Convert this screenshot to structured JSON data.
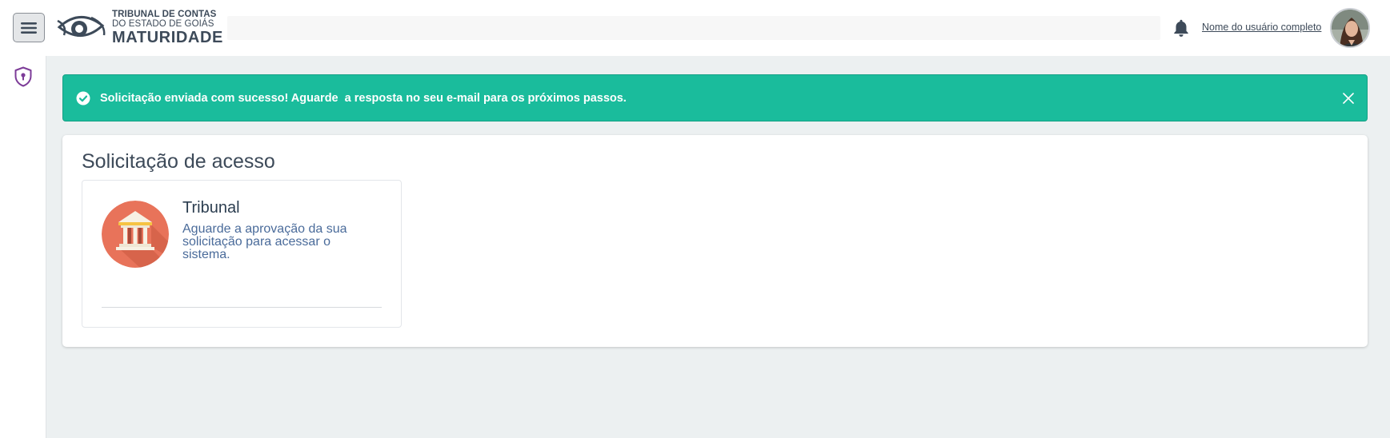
{
  "header": {
    "logo": {
      "line1": "TRIBUNAL DE CONTAS",
      "line2": "DO ESTADO DE GOIÁS",
      "line3": "MATURIDADE"
    },
    "search_placeholder": "",
    "username": "Nome do usuário completo"
  },
  "icons": {
    "menu": "hamburger-menu-icon",
    "bell": "bell-icon",
    "shield": "shield-keyhole-icon",
    "check": "check-circle-icon",
    "close": "close-icon",
    "tribunal": "courthouse-icon"
  },
  "alert": {
    "message": "Solicitação enviada com sucesso! Aguarde  a resposta no seu e-mail para os próximos passos."
  },
  "panel": {
    "title": "Solicitação de acesso",
    "card": {
      "title": "Tribunal",
      "description": "Aguarde a aprovação da sua solicitação para acessar o sistema."
    }
  },
  "colors": {
    "alert_bg": "#1abc9c",
    "main_bg": "#ecf0f1",
    "accent_purple": "#7d3c98",
    "tribunal_icon_bg": "#e8735a"
  }
}
